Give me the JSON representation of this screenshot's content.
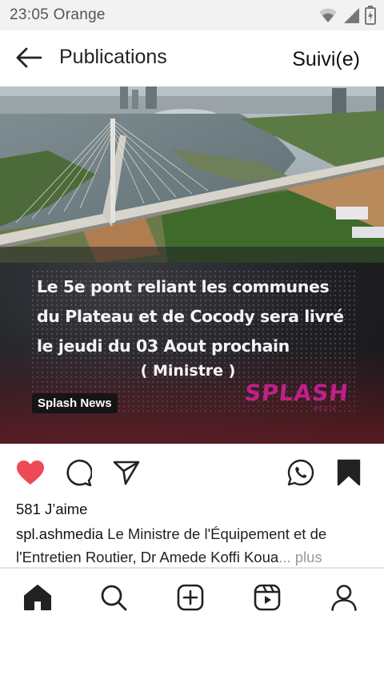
{
  "status_bar": {
    "time_carrier": "23:05  Orange",
    "icons": [
      "wifi-icon",
      "signal-icon",
      "battery-icon"
    ]
  },
  "header": {
    "back_icon": "arrow-left-icon",
    "title": "Publications",
    "follow_label": "Suivi(e)"
  },
  "post": {
    "image": {
      "headline": "Le 5e pont reliant les communes du Plateau et de Cocody sera  livré le jeudi du 03 Aout prochain",
      "headline_lines": [
        "Le 5e pont reliant les communes",
        "du Plateau et de Cocody sera  livré",
        "le jeudi du 03 Aout prochain"
      ],
      "subtitle": "( Ministre )",
      "badge": "Splash News",
      "logo": "SPLASH",
      "logo_sub": "MEDIA",
      "brand_color": "#c0208a"
    },
    "actions": {
      "like_icon": "heart-filled-icon",
      "comment_icon": "comment-icon",
      "share_icon": "send-icon",
      "whatsapp_icon": "whatsapp-icon",
      "save_icon": "bookmark-filled-icon",
      "like_color": "#ed4956"
    },
    "likes_text": "581 J’aime",
    "caption": {
      "username": "spl.ashmedia",
      "text": " Le Ministre de l'Équipement et de l'Entretien Routier, Dr Amede Koffi Koua",
      "ellipsis": "...",
      "more_label": " plus"
    }
  },
  "bottom_nav": {
    "items": [
      "home-icon",
      "search-icon",
      "add-post-icon",
      "reels-icon",
      "profile-icon"
    ]
  }
}
